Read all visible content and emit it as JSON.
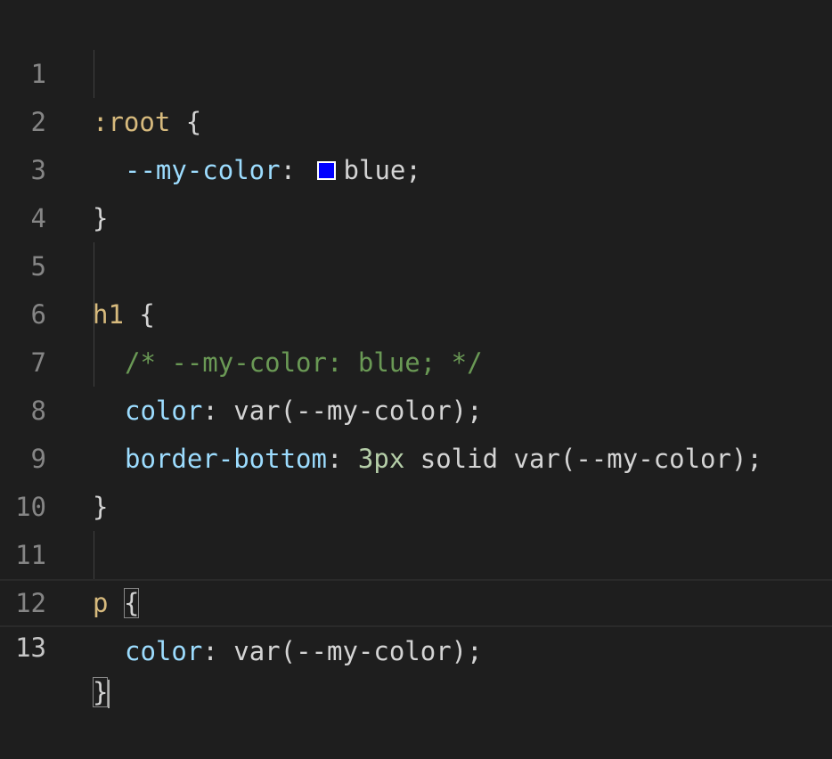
{
  "editor": {
    "language": "css",
    "current_line": 13,
    "colors": {
      "background": "#1e1e1e",
      "selector": "#d7ba7d",
      "property": "#9cdcfe",
      "comment": "#6a9955",
      "number": "#b5cea8",
      "swatch": "#0000ff"
    },
    "lines": [
      {
        "num": "1",
        "sel": ":root",
        "open": " {"
      },
      {
        "num": "2",
        "prop": "--my-color",
        "colon": ": ",
        "value": "blue;"
      },
      {
        "num": "3",
        "close": "}"
      },
      {
        "num": "4"
      },
      {
        "num": "5",
        "sel": "h1",
        "open": " {"
      },
      {
        "num": "6",
        "comment": "/* --my-color: blue; */"
      },
      {
        "num": "7",
        "prop": "color",
        "colon": ": ",
        "value": "var(--my-color);"
      },
      {
        "num": "8",
        "prop": "border-bottom",
        "colon": ": ",
        "number": "3px",
        "value": " solid var(--my-color);"
      },
      {
        "num": "9",
        "close": "}"
      },
      {
        "num": "10"
      },
      {
        "num": "11",
        "sel": "p",
        "space": " ",
        "brace": "{"
      },
      {
        "num": "12",
        "prop": "color",
        "colon": ": ",
        "value": "var(--my-color);"
      },
      {
        "num": "13",
        "brace": "}"
      }
    ]
  }
}
